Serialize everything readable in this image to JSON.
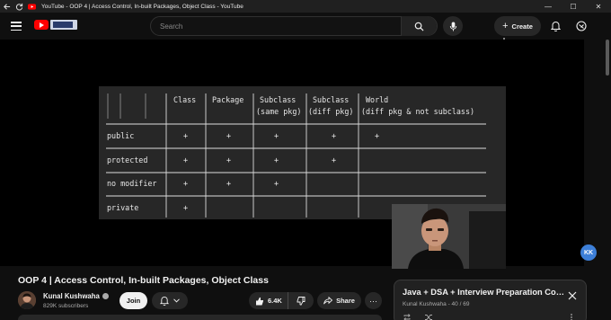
{
  "window": {
    "title": "YouTube - OOP 4 | Access Control, In-built Packages, Object Class - YouTube",
    "controls": [
      "—",
      "☐",
      "✕"
    ]
  },
  "masthead": {
    "search_placeholder": "Search",
    "create_label": "Create"
  },
  "slide": {
    "headers_row1": [
      "Class",
      "Package",
      "Subclass",
      "Subclass",
      "World"
    ],
    "headers_row2": [
      "",
      "",
      "(same pkg)",
      "(diff pkg)",
      "(diff pkg & not subclass)"
    ],
    "rows": [
      {
        "label": "public",
        "marks": [
          "+",
          "+",
          "+",
          "+",
          "+"
        ]
      },
      {
        "label": "protected",
        "marks": [
          "+",
          "+",
          "+",
          "+",
          ""
        ]
      },
      {
        "label": "no modifier",
        "marks": [
          "+",
          "+",
          "+",
          "",
          ""
        ]
      },
      {
        "label": "private",
        "marks": [
          "+",
          "",
          "",
          "",
          ""
        ]
      }
    ]
  },
  "badge": {
    "text": "KK"
  },
  "video": {
    "title": "OOP 4 | Access Control, In-built Packages, Object Class",
    "channel_name": "Kunal Kushwaha",
    "subscribers": "829K subscribers",
    "join_label": "Join",
    "like_count": "6.4K",
    "share_label": "Share"
  },
  "playlist": {
    "title": "Java + DSA + Interview Preparation Course",
    "subtitle": "Kunal Kushwaha - 40 / 69"
  },
  "colors": {
    "background": "#0f0f0f",
    "slide_background": "#272727",
    "brand_red": "#ff0000",
    "pill_background": "#272727",
    "badge_blue": "#3d7fd8"
  }
}
